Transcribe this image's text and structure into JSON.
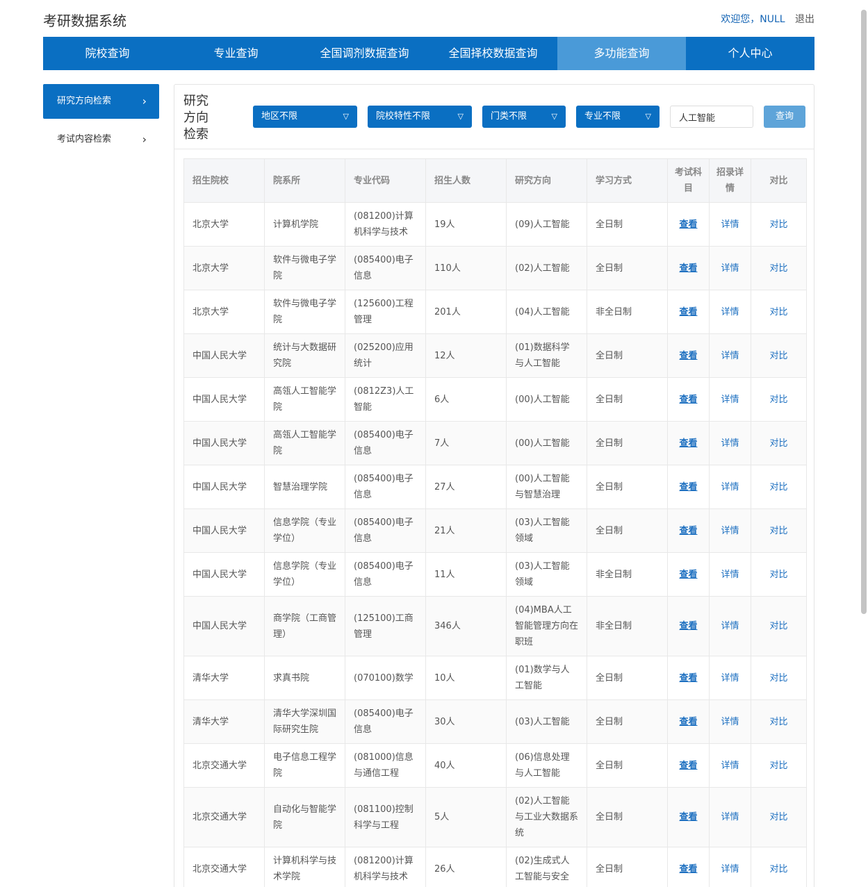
{
  "header": {
    "title": "考研数据系统",
    "welcome": "欢迎您，NULL",
    "logout": "退出"
  },
  "nav": [
    "院校查询",
    "专业查询",
    "全国调剂数据查询",
    "全国择校数据查询",
    "多功能查询",
    "个人中心"
  ],
  "nav_active_index": 4,
  "sidebar": [
    {
      "label": "研究方向检索",
      "active": true
    },
    {
      "label": "考试内容检索",
      "active": false
    }
  ],
  "filters": {
    "title": "研究方向检索",
    "selects": [
      "地区不限",
      "院校特性不限",
      "门类不限",
      "专业不限"
    ],
    "keyword": "人工智能",
    "query_label": "查询"
  },
  "table": {
    "headers": [
      "招生院校",
      "院系所",
      "专业代码",
      "招生人数",
      "研究方向",
      "学习方式",
      "考试科目",
      "招录详情",
      "对比"
    ],
    "rows": [
      {
        "school": "北京大学",
        "dept": "计算机学院",
        "code": "(081200)计算机科学与技术",
        "count": "19人",
        "direction": "(09)人工智能",
        "mode": "全日制",
        "exam": "查看",
        "detail": "详情",
        "compare": "对比"
      },
      {
        "school": "北京大学",
        "dept": "软件与微电子学院",
        "code": "(085400)电子信息",
        "count": "110人",
        "direction": "(02)人工智能",
        "mode": "全日制",
        "exam": "查看",
        "detail": "详情",
        "compare": "对比"
      },
      {
        "school": "北京大学",
        "dept": "软件与微电子学院",
        "code": "(125600)工程管理",
        "count": "201人",
        "direction": "(04)人工智能",
        "mode": "非全日制",
        "exam": "查看",
        "detail": "详情",
        "compare": "对比"
      },
      {
        "school": "中国人民大学",
        "dept": "统计与大数据研究院",
        "code": "(025200)应用统计",
        "count": "12人",
        "direction": "(01)数据科学与人工智能",
        "mode": "全日制",
        "exam": "查看",
        "detail": "详情",
        "compare": "对比"
      },
      {
        "school": "中国人民大学",
        "dept": "高瓴人工智能学院",
        "code": "(0812Z3)人工智能",
        "count": "6人",
        "direction": "(00)人工智能",
        "mode": "全日制",
        "exam": "查看",
        "detail": "详情",
        "compare": "对比"
      },
      {
        "school": "中国人民大学",
        "dept": "高瓴人工智能学院",
        "code": "(085400)电子信息",
        "count": "7人",
        "direction": "(00)人工智能",
        "mode": "全日制",
        "exam": "查看",
        "detail": "详情",
        "compare": "对比"
      },
      {
        "school": "中国人民大学",
        "dept": "智慧治理学院",
        "code": "(085400)电子信息",
        "count": "27人",
        "direction": "(00)人工智能与智慧治理",
        "mode": "全日制",
        "exam": "查看",
        "detail": "详情",
        "compare": "对比"
      },
      {
        "school": "中国人民大学",
        "dept": "信息学院（专业学位）",
        "code": "(085400)电子信息",
        "count": "21人",
        "direction": "(03)人工智能领域",
        "mode": "全日制",
        "exam": "查看",
        "detail": "详情",
        "compare": "对比"
      },
      {
        "school": "中国人民大学",
        "dept": "信息学院（专业学位）",
        "code": "(085400)电子信息",
        "count": "11人",
        "direction": "(03)人工智能领域",
        "mode": "非全日制",
        "exam": "查看",
        "detail": "详情",
        "compare": "对比"
      },
      {
        "school": "中国人民大学",
        "dept": "商学院（工商管理）",
        "code": "(125100)工商管理",
        "count": "346人",
        "direction": "(04)MBA人工智能管理方向在职班",
        "mode": "非全日制",
        "exam": "查看",
        "detail": "详情",
        "compare": "对比"
      },
      {
        "school": "清华大学",
        "dept": "求真书院",
        "code": "(070100)数学",
        "count": "10人",
        "direction": "(01)数学与人工智能",
        "mode": "全日制",
        "exam": "查看",
        "detail": "详情",
        "compare": "对比"
      },
      {
        "school": "清华大学",
        "dept": "清华大学深圳国际研究生院",
        "code": "(085400)电子信息",
        "count": "30人",
        "direction": "(03)人工智能",
        "mode": "全日制",
        "exam": "查看",
        "detail": "详情",
        "compare": "对比"
      },
      {
        "school": "北京交通大学",
        "dept": "电子信息工程学院",
        "code": "(081000)信息与通信工程",
        "count": "40人",
        "direction": "(06)信息处理与人工智能",
        "mode": "全日制",
        "exam": "查看",
        "detail": "详情",
        "compare": "对比"
      },
      {
        "school": "北京交通大学",
        "dept": "自动化与智能学院",
        "code": "(081100)控制科学与工程",
        "count": "5人",
        "direction": "(02)人工智能与工业大数据系统",
        "mode": "全日制",
        "exam": "查看",
        "detail": "详情",
        "compare": "对比"
      },
      {
        "school": "北京交通大学",
        "dept": "计算机科学与技术学院",
        "code": "(081200)计算机科学与技术",
        "count": "26人",
        "direction": "(02)生成式人工智能与安全",
        "mode": "全日制",
        "exam": "查看",
        "detail": "详情",
        "compare": "对比"
      }
    ]
  }
}
